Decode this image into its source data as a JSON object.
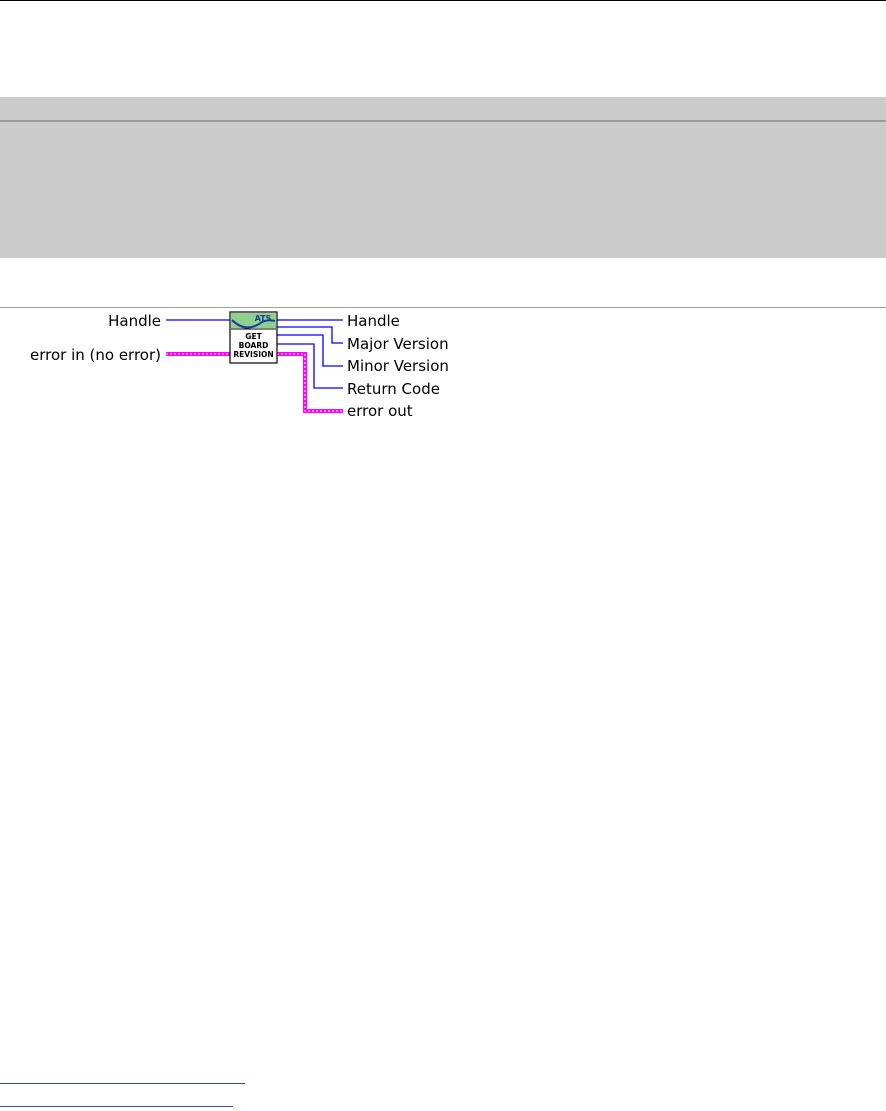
{
  "diagram": {
    "inputs": {
      "handle": "Handle",
      "error_in": "error in (no error)"
    },
    "outputs": {
      "handle": "Handle",
      "major_version": "Major Version",
      "minor_version": "Minor Version",
      "return_code": "Return Code",
      "error_out": "error out"
    },
    "vi_icon": {
      "brand": "ATS",
      "line1": "GET",
      "line2": "BOARD",
      "line3": "REVISION"
    },
    "colors": {
      "numeric_wire": "#0000ff",
      "error_wire": "#ff00ff",
      "icon_banner": "#8ed08e"
    }
  }
}
